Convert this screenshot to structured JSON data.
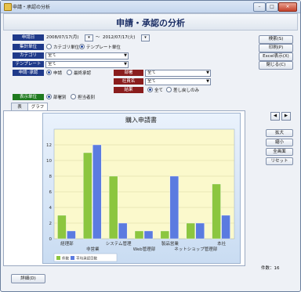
{
  "window": {
    "title": "申請・承認の分析",
    "min": "–",
    "max": "□",
    "close": "×"
  },
  "header": {
    "title": "申請・承認の分析"
  },
  "form": {
    "date_label": "申請日",
    "date_from": "2008/07/17(月)",
    "date_tilde": "～",
    "date_to": "2012/07/17(火)",
    "unit_label": "集計単位",
    "unit_opt1": "カテゴリ単位",
    "unit_opt2": "テンプレート単位",
    "category_label": "カテゴリ",
    "category_value": "全て",
    "template_label": "テンプレート",
    "template_value": "全て",
    "apply_label": "申請･承認",
    "apply_opt1": "申請",
    "apply_opt2": "最終承認",
    "dept_label": "部署",
    "dept_value": "全て",
    "emp_label": "社員名",
    "emp_value": "全て",
    "result_label": "結果",
    "result_opt1": "全て",
    "result_opt2": "差し戻しのみ",
    "display_label": "表示単位",
    "display_opt1": "部署別",
    "display_opt2": "担当者別"
  },
  "buttons": {
    "search": "検索(S)",
    "print": "印刷(P)",
    "excel": "Excel表示(X)",
    "close": "閉じる(C)",
    "zoom_in": "拡大",
    "zoom_out": "縮小",
    "fullscreen": "全画面",
    "reset": "リセット",
    "prev": "◀",
    "next": "▶",
    "details": "詳細(D)"
  },
  "tabs": [
    {
      "label": "表"
    },
    {
      "label": "グラフ"
    }
  ],
  "status": {
    "count": "件数：16"
  },
  "chart_data": {
    "type": "bar",
    "title": "購入申請書",
    "categories": [
      "経理部",
      "非営業",
      "システム管理",
      "Web管理部",
      "製品営業",
      "ネットショップ管理部",
      "本社"
    ],
    "series": [
      {
        "name": "件数",
        "color": "#8cc63f",
        "values": [
          3,
          11,
          8,
          1,
          1,
          2,
          7
        ]
      },
      {
        "name": "平均承認日数",
        "color": "#5b7be0",
        "values": [
          1,
          12,
          2,
          1,
          8,
          2,
          3
        ]
      }
    ],
    "ylim": [
      0,
      14
    ],
    "yticks": [
      0,
      2,
      4,
      6,
      8,
      10,
      12
    ],
    "legend_position": "bottom-left",
    "grid": true
  }
}
